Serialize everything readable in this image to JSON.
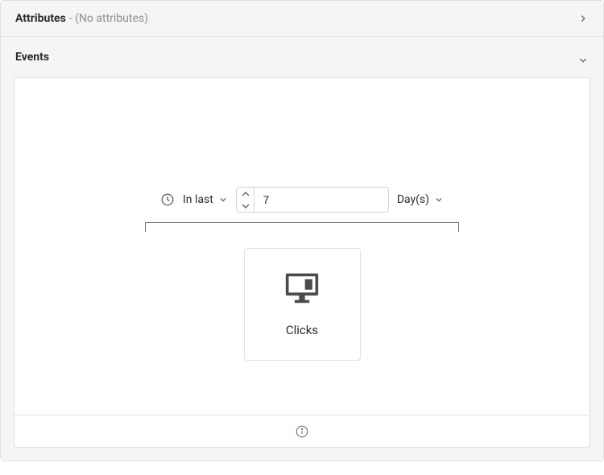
{
  "attributes": {
    "title": "Attributes",
    "subtitle": "- (No attributes)"
  },
  "events": {
    "title": "Events",
    "time": {
      "range_label": "In last",
      "value": "7",
      "unit_label": "Day(s)"
    },
    "card": {
      "label": "Clicks"
    }
  }
}
